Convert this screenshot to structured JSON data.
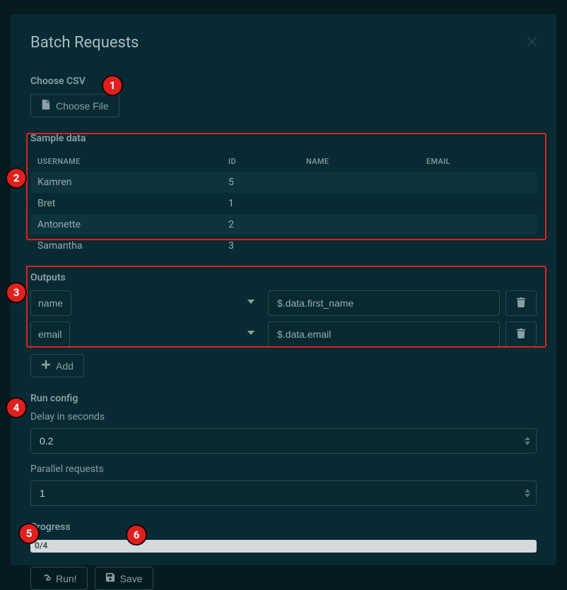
{
  "modal": {
    "title": "Batch Requests"
  },
  "csv": {
    "heading": "Choose CSV",
    "choose_btn": "Choose File"
  },
  "sample": {
    "heading": "Sample data",
    "columns": [
      "USERNAME",
      "ID",
      "NAME",
      "EMAIL"
    ],
    "rows": [
      {
        "username": "Kamren",
        "id": "5",
        "name": "",
        "email": ""
      },
      {
        "username": "Bret",
        "id": "1",
        "name": "",
        "email": ""
      },
      {
        "username": "Antonette",
        "id": "2",
        "name": "",
        "email": ""
      },
      {
        "username": "Samantha",
        "id": "3",
        "name": "",
        "email": ""
      }
    ]
  },
  "outputs": {
    "heading": "Outputs",
    "rows": [
      {
        "field": "name",
        "expr": "$.data.first_name"
      },
      {
        "field": "email",
        "expr": "$.data.email"
      }
    ],
    "add_btn": "Add"
  },
  "runconfig": {
    "heading": "Run config",
    "delay_label": "Delay in seconds",
    "delay_value": "0.2",
    "parallel_label": "Parallel requests",
    "parallel_value": "1"
  },
  "progress": {
    "heading": "Progress",
    "label": "0/4"
  },
  "actions": {
    "run": "Run!",
    "save": "Save"
  },
  "callouts": [
    "1",
    "2",
    "3",
    "4",
    "5",
    "6"
  ]
}
